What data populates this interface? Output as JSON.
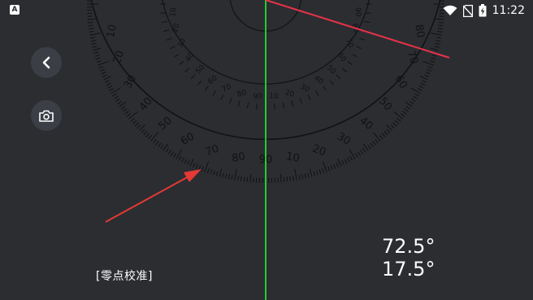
{
  "status_bar": {
    "app_badge": "A",
    "time": "11:22",
    "icons": [
      "wifi-icon",
      "no-sim-icon",
      "battery-charging-icon"
    ]
  },
  "protractor": {
    "outer_ticks": [
      "10",
      "20",
      "30",
      "40",
      "50",
      "60",
      "70",
      "80",
      "90",
      "10",
      "20",
      "30",
      "40",
      "50",
      "60",
      "70",
      "80"
    ],
    "inner_ticks": [
      "10",
      "20",
      "30",
      "40",
      "50",
      "60",
      "70",
      "80",
      "90",
      "10",
      "20",
      "30",
      "40",
      "50",
      "60",
      "70",
      "80",
      "90"
    ],
    "colors": {
      "scale": "#111214",
      "center_line": "#22cc33",
      "measure_line": "#e8324a",
      "hint_arrow": "#e53935"
    }
  },
  "controls": {
    "back_icon": "chevron-left-icon",
    "camera_icon": "camera-icon",
    "zero_calibration_label": "[零点校准]"
  },
  "readout": {
    "angle_primary": "72.5°",
    "angle_secondary": "17.5°"
  }
}
